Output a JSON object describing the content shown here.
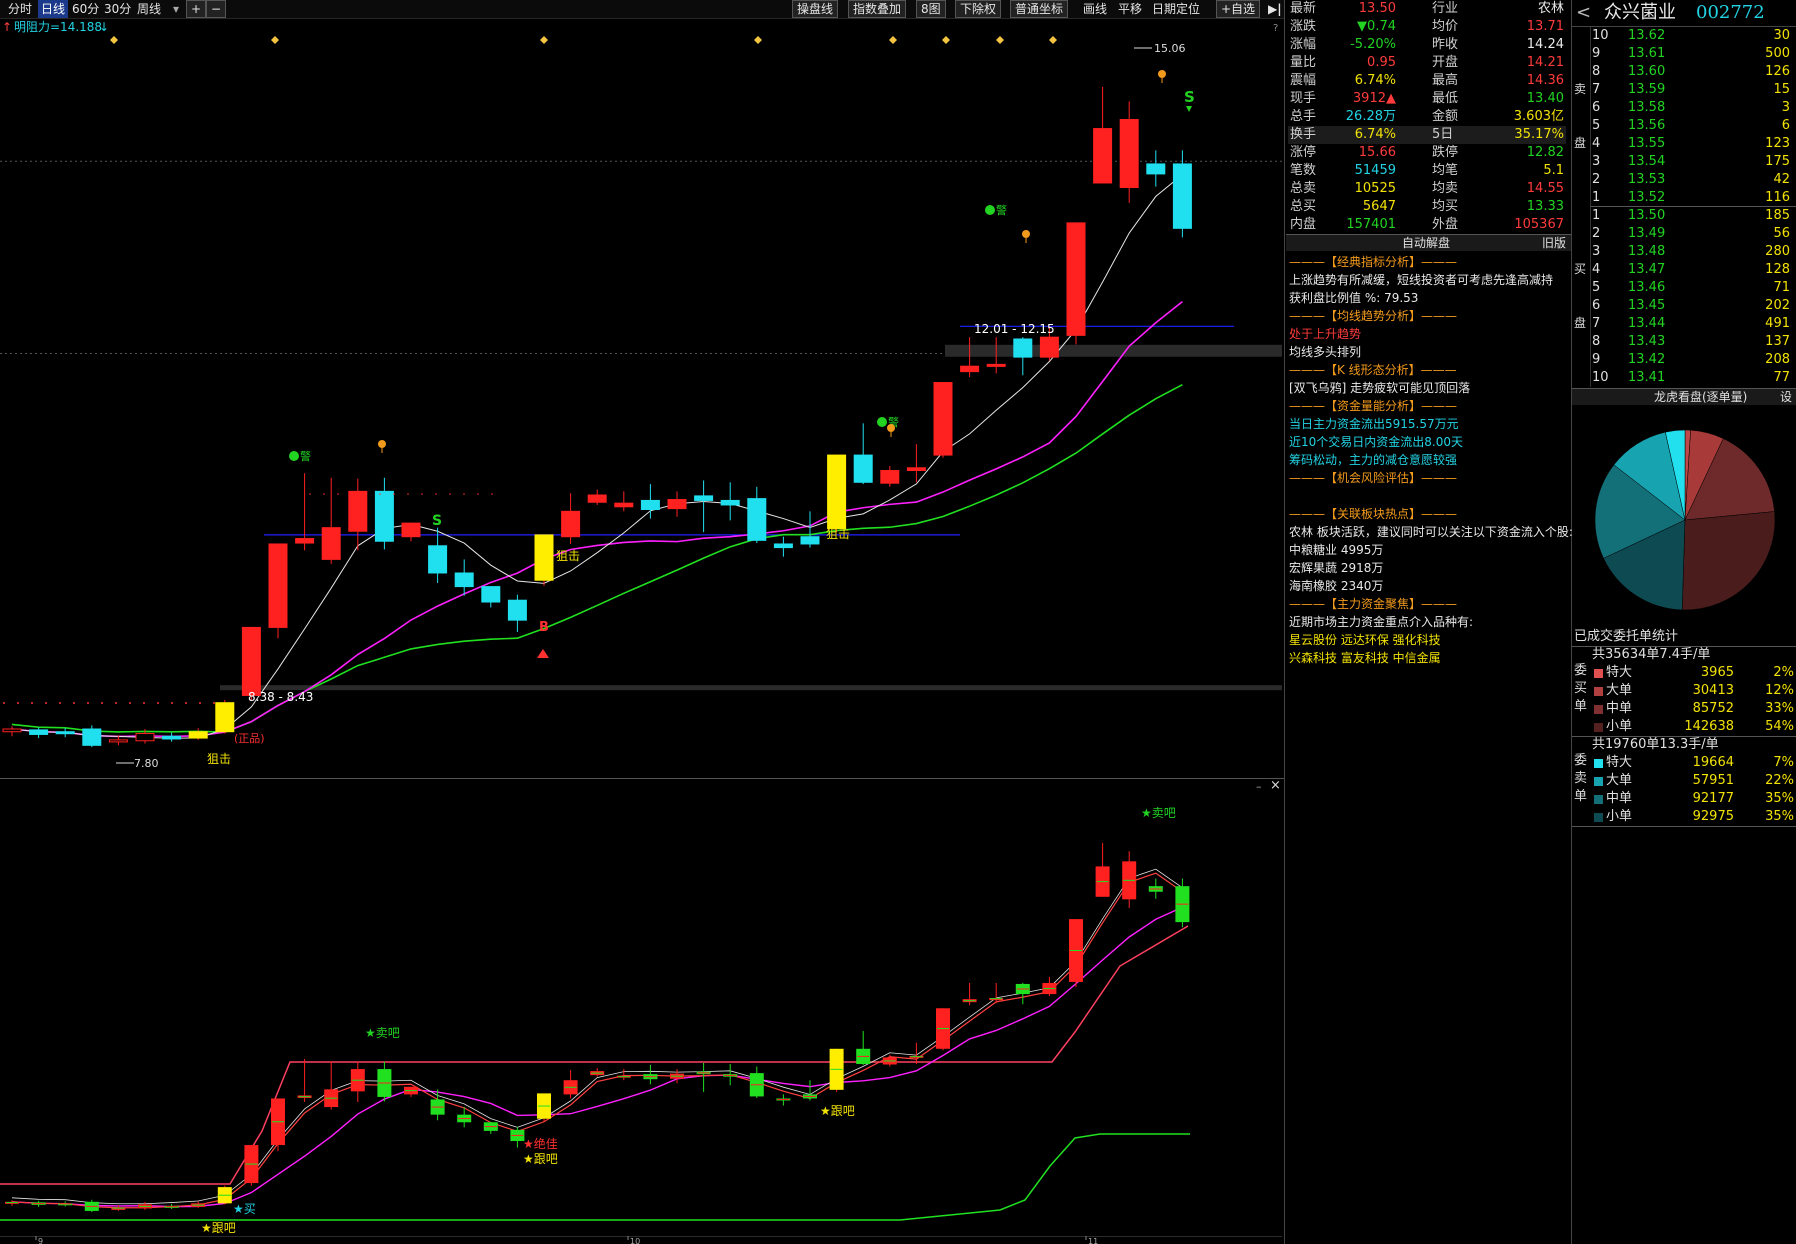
{
  "toolbar": {
    "tabs": [
      "分时",
      "日线",
      "60分",
      "30分",
      "周线"
    ],
    "active_tab": "日线",
    "zoom_in": "+",
    "zoom_out": "−",
    "menus": [
      "操盘线",
      "指数叠加",
      "8图",
      "下除权",
      "普通坐标"
    ],
    "draw": "画线",
    "pan": "平移",
    "date_locate": "日期定位",
    "watchlist": "+自选"
  },
  "indicator_label": "明阻力=14.188",
  "chart_labels": {
    "high_peak": "15.06",
    "zone_upper": "12.01 - 12.15",
    "zone_lower": "8.38 - 8.43",
    "low_point": "7.80",
    "snipe": "狙击",
    "warn": "警",
    "sell_signal": "S",
    "buy_signal": "B",
    "limit_up_note": "(正品)",
    "lower_sell": "★卖吧",
    "lower_follow": "★跟吧",
    "lower_buy": "★买",
    "lower_extreme": "★绝佳"
  },
  "stock": {
    "name": "众兴菌业",
    "code": "002772",
    "prev_icon": "<"
  },
  "quote": [
    {
      "k": "最新",
      "v": "13.50",
      "vc": "red",
      "k2": "行业",
      "v2": "农林",
      "v2c": "white"
    },
    {
      "k": "涨跌",
      "v": "▼0.74",
      "vc": "green",
      "k2": "均价",
      "v2": "13.71",
      "v2c": "red"
    },
    {
      "k": "涨幅",
      "v": "-5.20%",
      "vc": "green",
      "k2": "昨收",
      "v2": "14.24",
      "v2c": "white"
    },
    {
      "k": "量比",
      "v": "0.95",
      "vc": "red",
      "k2": "开盘",
      "v2": "14.21",
      "v2c": "red"
    },
    {
      "k": "震幅",
      "v": "6.74%",
      "vc": "yellow",
      "k2": "最高",
      "v2": "14.36",
      "v2c": "red"
    },
    {
      "k": "现手",
      "v": "3912▲",
      "vc": "red",
      "k2": "最低",
      "v2": "13.40",
      "v2c": "green"
    },
    {
      "k": "总手",
      "v": "26.28万",
      "vc": "cyan",
      "k2": "金额",
      "v2": "3.603亿",
      "v2c": "yellow"
    },
    {
      "k": "换手",
      "v": "6.74%",
      "vc": "yellow",
      "k2": "5日",
      "v2": "35.17%",
      "v2c": "yellow"
    },
    {
      "k": "涨停",
      "v": "15.66",
      "vc": "red",
      "k2": "跌停",
      "v2": "12.82",
      "v2c": "green"
    },
    {
      "k": "笔数",
      "v": "51459",
      "vc": "cyan",
      "k2": "均笔",
      "v2": "5.1",
      "v2c": "yellow"
    },
    {
      "k": "总卖",
      "v": "10525",
      "vc": "yellow",
      "k2": "均卖",
      "v2": "14.55",
      "v2c": "red"
    },
    {
      "k": "总买",
      "v": "5647",
      "vc": "yellow",
      "k2": "均买",
      "v2": "13.33",
      "v2c": "green"
    },
    {
      "k": "内盘",
      "v": "157401",
      "vc": "green",
      "k2": "外盘",
      "v2": "105367",
      "v2c": "red"
    }
  ],
  "order_book": {
    "sell_label": [
      "卖",
      "盘"
    ],
    "buy_label": [
      "买",
      "盘"
    ],
    "sells": [
      {
        "lv": "10",
        "p": "13.62",
        "vol": "30"
      },
      {
        "lv": "9",
        "p": "13.61",
        "vol": "500"
      },
      {
        "lv": "8",
        "p": "13.60",
        "vol": "126"
      },
      {
        "lv": "7",
        "p": "13.59",
        "vol": "15"
      },
      {
        "lv": "6",
        "p": "13.58",
        "vol": "3"
      },
      {
        "lv": "5",
        "p": "13.56",
        "vol": "6"
      },
      {
        "lv": "4",
        "p": "13.55",
        "vol": "123"
      },
      {
        "lv": "3",
        "p": "13.54",
        "vol": "175"
      },
      {
        "lv": "2",
        "p": "13.53",
        "vol": "42"
      },
      {
        "lv": "1",
        "p": "13.52",
        "vol": "116"
      }
    ],
    "buys": [
      {
        "lv": "1",
        "p": "13.50",
        "vol": "185"
      },
      {
        "lv": "2",
        "p": "13.49",
        "vol": "56"
      },
      {
        "lv": "3",
        "p": "13.48",
        "vol": "280"
      },
      {
        "lv": "4",
        "p": "13.47",
        "vol": "128"
      },
      {
        "lv": "5",
        "p": "13.46",
        "vol": "71"
      },
      {
        "lv": "6",
        "p": "13.45",
        "vol": "202"
      },
      {
        "lv": "7",
        "p": "13.44",
        "vol": "491"
      },
      {
        "lv": "8",
        "p": "13.43",
        "vol": "137"
      },
      {
        "lv": "9",
        "p": "13.42",
        "vol": "208"
      },
      {
        "lv": "10",
        "p": "13.41",
        "vol": "77"
      }
    ]
  },
  "analysis": {
    "title": "自动解盘",
    "old_version": "旧版",
    "lines": [
      {
        "t": "———【经典指标分析】———",
        "c": "orange"
      },
      {
        "t": "上涨趋势有所减缓，短线投资者可考虑先逢高减持",
        "c": "white"
      },
      {
        "t": "获利盘比例值 %: 79.53",
        "c": "white"
      },
      {
        "t": "———【均线趋势分析】———",
        "c": "orange"
      },
      {
        "t": "处于上升趋势",
        "c": "red"
      },
      {
        "t": "均线多头排列",
        "c": "white"
      },
      {
        "t": "———【K 线形态分析】———",
        "c": "orange"
      },
      {
        "t": "[双飞乌鸦] 走势疲软可能见顶回落",
        "c": "white"
      },
      {
        "t": "———【资金量能分析】———",
        "c": "orange"
      },
      {
        "t": "当日主力资金流出5915.57万元",
        "c": "cyan"
      },
      {
        "t": "近10个交易日内资金流出8.00天",
        "c": "cyan"
      },
      {
        "t": "筹码松动，主力的减仓意愿较强",
        "c": "cyan"
      },
      {
        "t": "———【机会风险评估】———",
        "c": "orange"
      },
      {
        "t": "",
        "c": "white"
      },
      {
        "t": "———【关联板块热点】———",
        "c": "orange"
      },
      {
        "t": "农林 板块活跃，建议同时可以关注以下资金流入个股:",
        "c": "white"
      },
      {
        "t": "中粮糖业 4995万",
        "c": "white"
      },
      {
        "t": "宏辉果蔬 2918万",
        "c": "white"
      },
      {
        "t": "海南橡胶 2340万",
        "c": "white"
      },
      {
        "t": "———【主力资金聚焦】———",
        "c": "orange"
      },
      {
        "t": "近期市场主力资金重点介入品种有:",
        "c": "white"
      },
      {
        "t": "星云股份  远达环保  强化科技",
        "c": "yellow"
      },
      {
        "t": "兴森科技  富友科技  中信金属",
        "c": "yellow"
      }
    ]
  },
  "dragon_tiger": {
    "title": "龙虎看盘(逐单量)",
    "settings": "设"
  },
  "pie": [
    {
      "label": "特大买",
      "value": 2,
      "color": "#c04848"
    },
    {
      "label": "大买",
      "value": 12,
      "color": "#a83a3a"
    },
    {
      "label": "中买",
      "value": 33,
      "color": "#6e2a2a"
    },
    {
      "label": "小买",
      "value": 54,
      "color": "#4a1c1c"
    },
    {
      "label": "小卖",
      "value": 35,
      "color": "#0e4a52"
    },
    {
      "label": "中卖",
      "value": 35,
      "color": "#137078"
    },
    {
      "label": "大卖",
      "value": 22,
      "color": "#17a3b0"
    },
    {
      "label": "特大卖",
      "value": 7,
      "color": "#22e0ee"
    }
  ],
  "order_stats": {
    "title": "已成交委托单统计",
    "buy_summary": "共35634单7.4手/单",
    "buy_side": "委买单",
    "buy_rows": [
      {
        "n": "特大",
        "c": "3965",
        "p": "2%",
        "col": "#e05050"
      },
      {
        "n": "大单",
        "c": "30413",
        "p": "12%",
        "col": "#b04040"
      },
      {
        "n": "中单",
        "c": "85752",
        "p": "33%",
        "col": "#803030"
      },
      {
        "n": "小单",
        "c": "142638",
        "p": "54%",
        "col": "#552020"
      }
    ],
    "sell_summary": "共19760单13.3手/单",
    "sell_side": "委卖单",
    "sell_rows": [
      {
        "n": "特大",
        "c": "19664",
        "p": "7%",
        "col": "#22e0ee"
      },
      {
        "n": "大单",
        "c": "57951",
        "p": "22%",
        "col": "#17a3b0"
      },
      {
        "n": "中单",
        "c": "92177",
        "p": "35%",
        "col": "#137078"
      },
      {
        "n": "小单",
        "c": "92975",
        "p": "35%",
        "col": "#0e4a52"
      }
    ]
  },
  "candles": [
    [
      7.95,
      7.98,
      7.9,
      8.01
    ],
    [
      7.97,
      7.92,
      7.88,
      8.0
    ],
    [
      7.95,
      7.93,
      7.89,
      7.99
    ],
    [
      7.98,
      7.8,
      7.78,
      8.02
    ],
    [
      7.85,
      7.86,
      7.8,
      7.91
    ],
    [
      7.85,
      7.93,
      7.82,
      7.98
    ],
    [
      7.9,
      7.87,
      7.84,
      7.94
    ],
    [
      7.88,
      7.95,
      7.86,
      7.99
    ],
    [
      7.95,
      8.27,
      7.93,
      8.3
    ],
    [
      8.35,
      9.1,
      8.3,
      9.1
    ],
    [
      9.1,
      10.02,
      8.98,
      10.02
    ],
    [
      10.03,
      10.08,
      9.95,
      10.8
    ],
    [
      9.85,
      10.2,
      9.8,
      10.75
    ],
    [
      10.16,
      10.6,
      9.95,
      10.74
    ],
    [
      10.6,
      10.05,
      9.96,
      10.75
    ],
    [
      10.1,
      10.25,
      10.05,
      10.25
    ],
    [
      10.0,
      9.7,
      9.59,
      10.2
    ],
    [
      9.7,
      9.55,
      9.45,
      9.85
    ],
    [
      9.55,
      9.38,
      9.32,
      9.55
    ],
    [
      9.4,
      9.18,
      9.05,
      9.46
    ],
    [
      9.62,
      10.12,
      9.56,
      10.12
    ],
    [
      10.1,
      10.38,
      10.02,
      10.58
    ],
    [
      10.48,
      10.56,
      10.45,
      10.62
    ],
    [
      10.43,
      10.47,
      10.38,
      10.6
    ],
    [
      10.5,
      10.4,
      10.3,
      10.68
    ],
    [
      10.41,
      10.51,
      10.32,
      10.6
    ],
    [
      10.55,
      10.5,
      10.15,
      10.72
    ],
    [
      10.5,
      10.45,
      10.28,
      10.7
    ],
    [
      10.52,
      10.06,
      10.03,
      10.65
    ],
    [
      10.02,
      9.98,
      9.88,
      10.1
    ],
    [
      10.1,
      10.02,
      9.98,
      10.38
    ],
    [
      10.19,
      11.0,
      10.15,
      11.0
    ],
    [
      11.0,
      10.7,
      10.68,
      11.35
    ],
    [
      10.69,
      10.83,
      10.65,
      10.88
    ],
    [
      10.83,
      10.86,
      10.7,
      11.12
    ],
    [
      11.0,
      11.8,
      10.97,
      11.8
    ],
    [
      11.92,
      11.98,
      11.86,
      12.3
    ],
    [
      11.98,
      12.0,
      11.9,
      12.3
    ],
    [
      12.28,
      12.08,
      11.88,
      12.3
    ],
    [
      12.08,
      12.3,
      12.04,
      12.42
    ],
    [
      12.32,
      13.56,
      12.22,
      13.56
    ],
    [
      14.0,
      14.6,
      14.0,
      15.06
    ],
    [
      13.95,
      14.7,
      13.78,
      14.9
    ],
    [
      14.21,
      14.1,
      13.96,
      14.36
    ],
    [
      14.21,
      13.5,
      13.4,
      14.36
    ]
  ],
  "lower_candles": [
    [
      7.95,
      7.98,
      7.9,
      8.01
    ],
    [
      7.97,
      7.92,
      7.88,
      8.0
    ],
    [
      7.95,
      7.93,
      7.89,
      7.99
    ],
    [
      7.98,
      7.8,
      7.78,
      8.02
    ],
    [
      7.85,
      7.86,
      7.8,
      7.91
    ],
    [
      7.85,
      7.93,
      7.82,
      7.98
    ],
    [
      7.9,
      7.87,
      7.84,
      7.94
    ],
    [
      7.88,
      7.95,
      7.86,
      7.99
    ],
    [
      7.95,
      8.27,
      7.93,
      8.3
    ],
    [
      8.35,
      9.1,
      8.3,
      9.1
    ],
    [
      9.1,
      10.02,
      8.98,
      10.02
    ],
    [
      10.03,
      10.08,
      9.95,
      10.8
    ],
    [
      9.85,
      10.2,
      9.8,
      10.75
    ],
    [
      10.16,
      10.6,
      9.95,
      10.74
    ],
    [
      10.6,
      10.05,
      9.96,
      10.75
    ],
    [
      10.1,
      10.25,
      10.05,
      10.25
    ],
    [
      10.0,
      9.7,
      9.59,
      10.2
    ],
    [
      9.7,
      9.55,
      9.45,
      9.85
    ],
    [
      9.55,
      9.38,
      9.32,
      9.55
    ],
    [
      9.4,
      9.18,
      9.05,
      9.46
    ],
    [
      9.62,
      10.12,
      9.56,
      10.12
    ],
    [
      10.1,
      10.38,
      10.02,
      10.58
    ],
    [
      10.48,
      10.56,
      10.45,
      10.62
    ],
    [
      10.43,
      10.47,
      10.38,
      10.6
    ],
    [
      10.5,
      10.4,
      10.3,
      10.68
    ],
    [
      10.41,
      10.51,
      10.32,
      10.6
    ],
    [
      10.55,
      10.5,
      10.15,
      10.72
    ],
    [
      10.5,
      10.45,
      10.28,
      10.7
    ],
    [
      10.52,
      10.06,
      10.03,
      10.65
    ],
    [
      10.02,
      9.98,
      9.88,
      10.1
    ],
    [
      10.1,
      10.02,
      9.98,
      10.38
    ],
    [
      10.19,
      11.0,
      10.15,
      11.0
    ],
    [
      11.0,
      10.7,
      10.68,
      11.35
    ],
    [
      10.69,
      10.83,
      10.65,
      10.88
    ],
    [
      10.83,
      10.86,
      10.7,
      11.12
    ],
    [
      11.0,
      11.8,
      10.97,
      11.8
    ],
    [
      11.92,
      11.98,
      11.86,
      12.3
    ],
    [
      11.98,
      12.0,
      11.9,
      12.3
    ],
    [
      12.28,
      12.08,
      11.88,
      12.3
    ],
    [
      12.08,
      12.3,
      12.04,
      12.42
    ],
    [
      12.32,
      13.56,
      12.22,
      13.56
    ],
    [
      14.0,
      14.6,
      14.0,
      15.06
    ],
    [
      13.95,
      14.7,
      13.78,
      14.9
    ],
    [
      14.21,
      14.1,
      13.96,
      14.36
    ],
    [
      14.21,
      13.5,
      13.4,
      14.36
    ]
  ],
  "bottom_axis": [
    "9",
    "10",
    "11"
  ],
  "colors": {
    "up": "#ff2020",
    "down": "#20e0f0",
    "limit": "#ffee00",
    "ma_white": "#e6e6e6",
    "ma_magenta": "#ff20ff",
    "ma_green": "#20e020",
    "blue_line": "#2020ff"
  }
}
